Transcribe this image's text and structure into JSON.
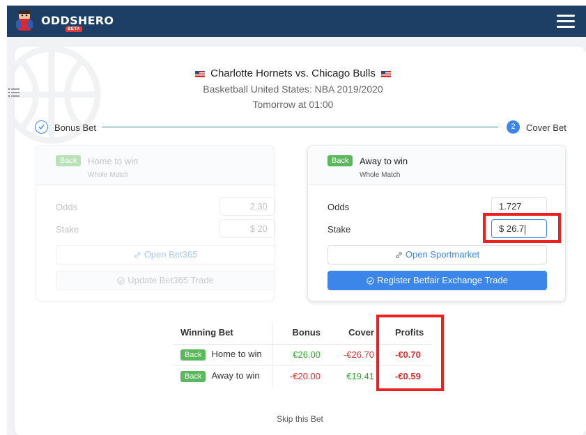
{
  "brand": {
    "name": "ODDSHERO",
    "tag": "BETA"
  },
  "match": {
    "title": "Charlotte Hornets vs. Chicago Bulls",
    "league": "Basketball United States: NBA 2019/2020",
    "time": "Tomorrow at 01:00"
  },
  "stepper": {
    "step1_label": "Bonus Bet",
    "step2_number": "2",
    "step2_label": "Cover Bet"
  },
  "bonus_bet": {
    "badge": "Back",
    "selection": "Home to win",
    "market": "Whole Match",
    "odds_label": "Odds",
    "odds_value": "2.30",
    "stake_label": "Stake",
    "stake_value": "$ 20",
    "open_button": "Open Bet365",
    "update_button": "Update Bet365 Trade"
  },
  "cover_bet": {
    "badge": "Back",
    "selection": "Away to win",
    "market": "Whole Match",
    "odds_label": "Odds",
    "odds_value": "1.727",
    "stake_label": "Stake",
    "stake_value": "$ 26.7",
    "open_button": "Open Sportmarket",
    "register_button": "Register Betfair Exchange Trade"
  },
  "results": {
    "headers": [
      "Winning Bet",
      "Bonus",
      "Cover",
      "Profits"
    ],
    "rows": [
      {
        "badge": "Back",
        "outcome": "Home to win",
        "bonus": "€26.00",
        "cover": "-€26.70",
        "profit": "-€0.70"
      },
      {
        "badge": "Back",
        "outcome": "Away to win",
        "bonus": "-€20.00",
        "cover": "€19.41",
        "profit": "-€0.59"
      }
    ]
  },
  "skip_link": "Skip this Bet",
  "colors": {
    "navbar": "#1d3f66",
    "accent": "#3b86e8",
    "back_badge": "#5cb85c",
    "positive": "#2fa82f",
    "negative": "#dc3030",
    "highlight_box": "#ee1f1f"
  },
  "icons": [
    "mascot-logo-icon",
    "hamburger-menu-icon",
    "list-icon",
    "us-flag-icon",
    "check-circle-icon",
    "link-icon"
  ]
}
